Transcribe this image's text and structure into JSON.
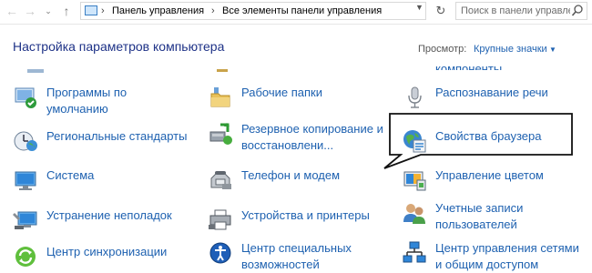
{
  "address": {
    "path": [
      "Панель управления",
      "Все элементы панели управления"
    ],
    "search_placeholder": "Поиск в панели управления"
  },
  "header": {
    "title": "Настройка параметров компьютера",
    "view_label": "Просмотр:",
    "view_value": "Крупные значки"
  },
  "cut_item": "компоненты",
  "items": [
    {
      "line1": "Программы по",
      "line2": "умолчанию"
    },
    {
      "line1": "Рабочие папки",
      "line2": ""
    },
    {
      "line1": "Распознавание речи",
      "line2": ""
    },
    {
      "line1": "Региональные стандарты",
      "line2": ""
    },
    {
      "line1": "Резервное копирование и",
      "line2": "восстановлени..."
    },
    {
      "line1": "Свойства браузера",
      "line2": ""
    },
    {
      "line1": "Система",
      "line2": ""
    },
    {
      "line1": "Телефон и модем",
      "line2": ""
    },
    {
      "line1": "Управление цветом",
      "line2": ""
    },
    {
      "line1": "Устранение неполадок",
      "line2": ""
    },
    {
      "line1": "Устройства и принтеры",
      "line2": ""
    },
    {
      "line1": "Учетные записи",
      "line2": "пользователей"
    },
    {
      "line1": "Центр синхронизации",
      "line2": ""
    },
    {
      "line1": "Центр специальных",
      "line2": "возможностей"
    },
    {
      "line1": "Центр управления сетями",
      "line2": "и общим доступом"
    }
  ]
}
